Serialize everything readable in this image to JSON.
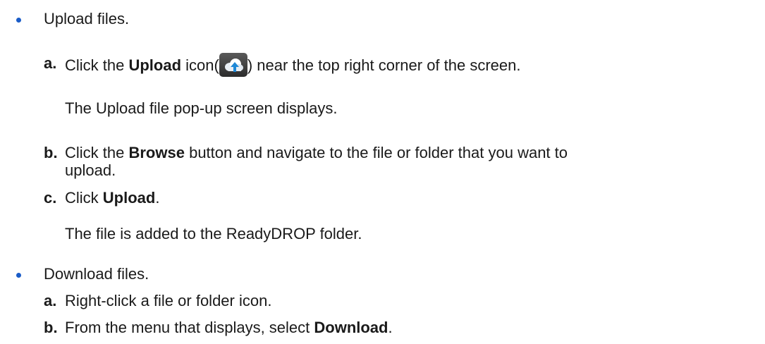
{
  "upload": {
    "heading": "Upload files.",
    "steps": [
      {
        "letter": "a.",
        "pre": "Click the ",
        "bold": "Upload",
        "post1": " icon(",
        "post2": ") near the top right corner of the screen."
      },
      {
        "letter": "b.",
        "pre": "Click the ",
        "bold": "Browse",
        "post": " button and navigate to the file or folder that you want to",
        "cont": "upload."
      },
      {
        "letter": "c.",
        "pre": "Click ",
        "bold": "Upload",
        "post": "."
      }
    ],
    "note_a": "The Upload file pop-up screen displays.",
    "note_c": "The file is added to the ReadyDROP folder."
  },
  "download": {
    "heading": "Download files.",
    "steps": [
      {
        "letter": "a.",
        "text": "Right-click a file or folder icon."
      },
      {
        "letter": "b.",
        "pre": "From the menu that displays, select ",
        "bold": "Download",
        "post": "."
      }
    ]
  },
  "colors": {
    "bullet": "#1a5cc8",
    "text": "#1a1a1a"
  },
  "icons": [
    "upload-cloud-icon"
  ]
}
